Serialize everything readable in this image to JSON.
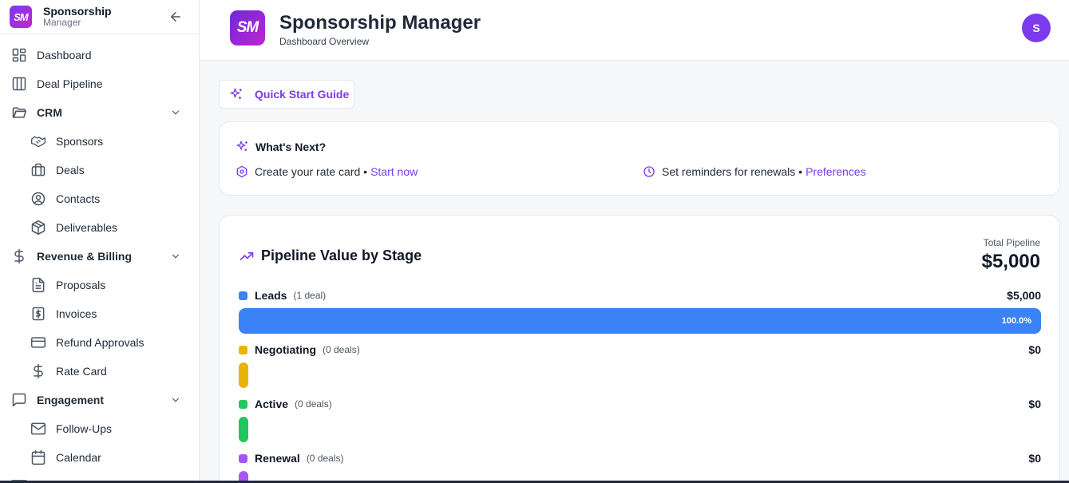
{
  "sidebar": {
    "brand_title": "Sponsorship",
    "brand_subtitle": "Manager",
    "logo_text": "SM",
    "items": [
      {
        "label": "Dashboard",
        "icon": "grid-icon"
      },
      {
        "label": "Deal Pipeline",
        "icon": "columns-icon"
      },
      {
        "label": "CRM",
        "icon": "folder-icon",
        "group": true
      },
      {
        "label": "Sponsors",
        "icon": "handshake-icon"
      },
      {
        "label": "Deals",
        "icon": "briefcase-icon"
      },
      {
        "label": "Contacts",
        "icon": "user-circle-icon"
      },
      {
        "label": "Deliverables",
        "icon": "package-icon"
      },
      {
        "label": "Revenue & Billing",
        "icon": "dollar-icon",
        "group": true
      },
      {
        "label": "Proposals",
        "icon": "file-text-icon"
      },
      {
        "label": "Invoices",
        "icon": "receipt-icon"
      },
      {
        "label": "Refund Approvals",
        "icon": "credit-card-icon"
      },
      {
        "label": "Rate Card",
        "icon": "dollar-icon"
      },
      {
        "label": "Engagement",
        "icon": "message-square-icon",
        "group": true
      },
      {
        "label": "Follow-Ups",
        "icon": "mail-icon"
      },
      {
        "label": "Calendar",
        "icon": "calendar-icon"
      }
    ]
  },
  "header": {
    "logo_text": "SM",
    "title": "Sponsorship Manager",
    "subtitle": "Dashboard Overview",
    "avatar_initial": "S"
  },
  "quick_start": {
    "label": "Quick Start Guide"
  },
  "whats_next": {
    "title": "What's Next?",
    "items": [
      {
        "text": "Create your rate card •",
        "link": "Start now"
      },
      {
        "text": "Set reminders for renewals •",
        "link": "Preferences"
      }
    ]
  },
  "pipeline": {
    "title": "Pipeline Value by Stage",
    "total_label": "Total Pipeline",
    "total_value": "$5,000",
    "stages": [
      {
        "name": "Leads",
        "count": "(1 deal)",
        "value": "$5,000",
        "pct": 100,
        "pct_label": "100.0%",
        "color": "#3b82f6"
      },
      {
        "name": "Negotiating",
        "count": "(0 deals)",
        "value": "$0",
        "pct": 0,
        "pct_label": "",
        "color": "#eab308"
      },
      {
        "name": "Active",
        "count": "(0 deals)",
        "value": "$0",
        "pct": 0,
        "pct_label": "",
        "color": "#22c55e"
      },
      {
        "name": "Renewal",
        "count": "(0 deals)",
        "value": "$0",
        "pct": 0,
        "pct_label": "",
        "color": "#a855f7"
      }
    ]
  },
  "colors": {
    "accent": "#7c3aed"
  }
}
